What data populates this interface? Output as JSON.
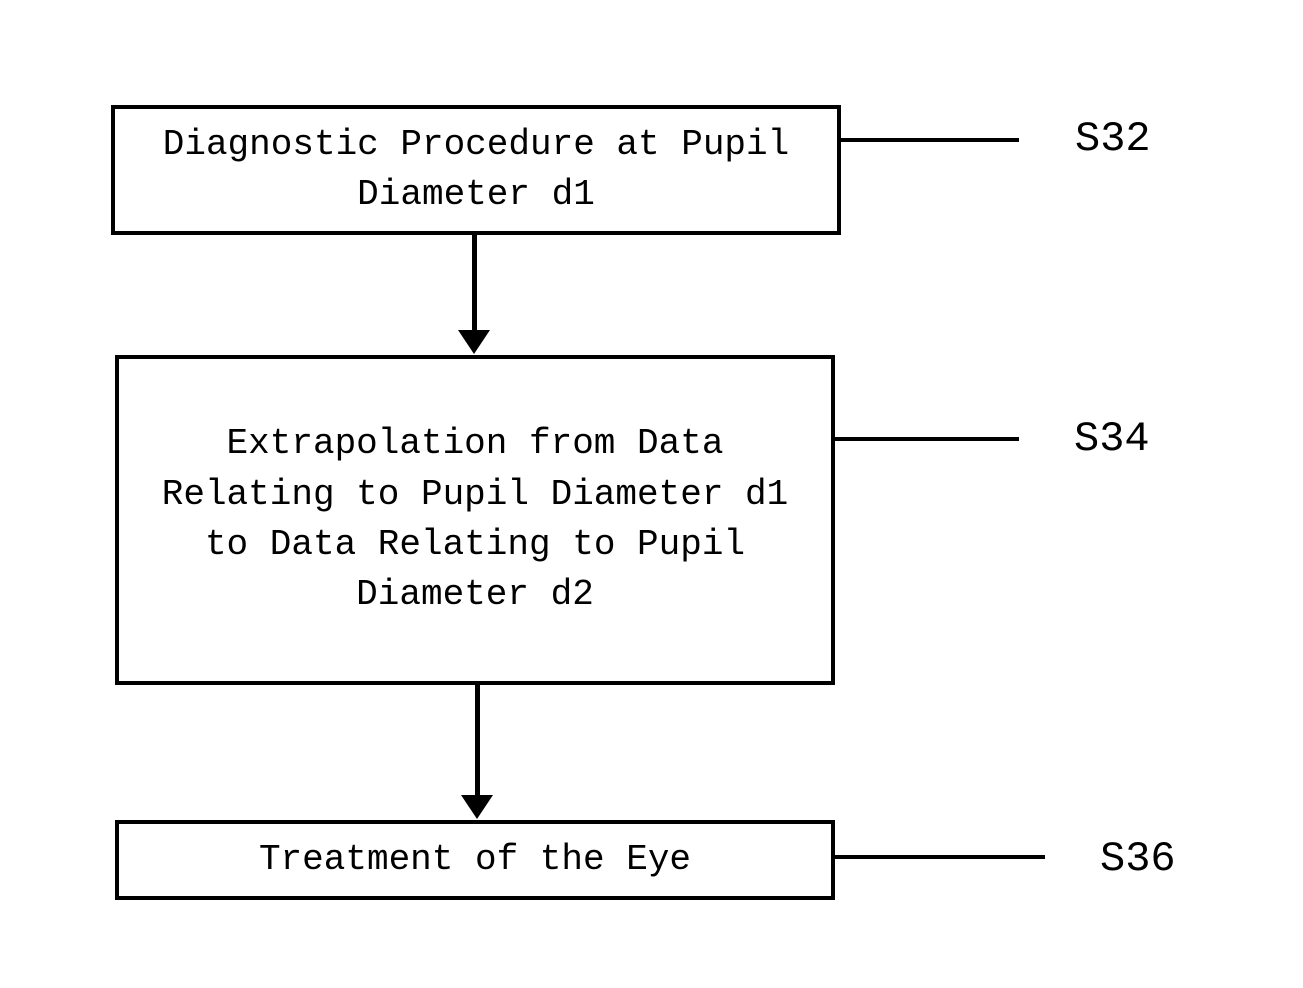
{
  "boxes": {
    "step1": "Diagnostic Procedure at Pupil Diameter d1",
    "step2": "Extrapolation from Data Relating to Pupil Diameter d1 to Data Relating to Pupil Diameter d2",
    "step3": "Treatment of the Eye"
  },
  "labels": {
    "s32": "S32",
    "s34": "S34",
    "s36": "S36"
  }
}
